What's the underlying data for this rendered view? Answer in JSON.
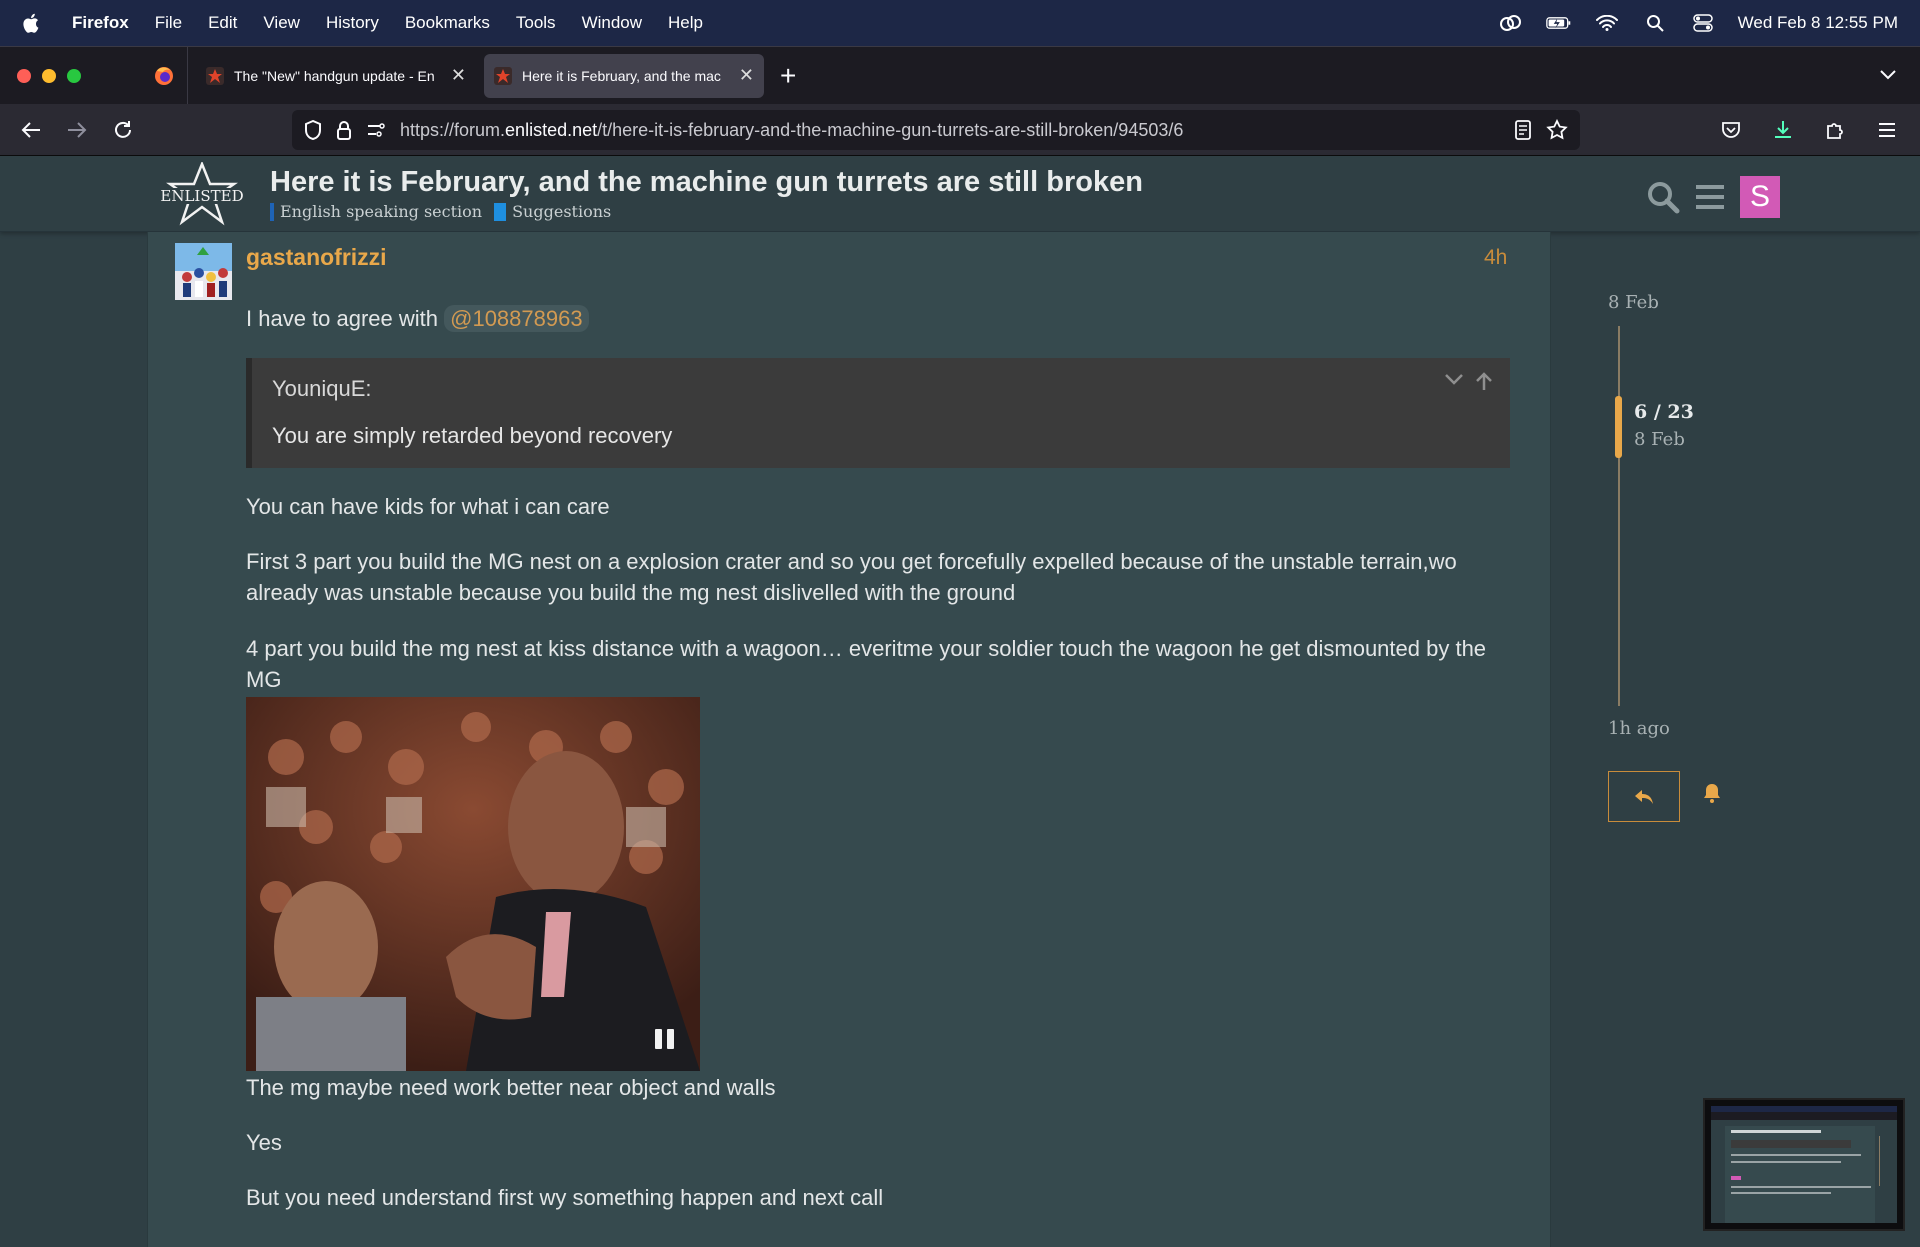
{
  "menubar": {
    "app_name": "Firefox",
    "items": [
      "File",
      "Edit",
      "View",
      "History",
      "Bookmarks",
      "Tools",
      "Window",
      "Help"
    ],
    "clock": "Wed Feb 8  12:55 PM"
  },
  "tabs": [
    {
      "title": "The \"New\" handgun update - En",
      "active": false
    },
    {
      "title": "Here it is February, and the mac",
      "active": true
    }
  ],
  "url": {
    "prefix": "https://forum.",
    "domain": "enlisted.net",
    "path": "/t/here-it-is-february-and-the-machine-gun-turrets-are-still-broken/94503/6"
  },
  "topic": {
    "title": "Here it is February, and the machine gun turrets are still broken",
    "categories": [
      {
        "name": "English speaking section",
        "color": "#1e63b6"
      },
      {
        "name": "Suggestions",
        "color": "#1e8fe0"
      }
    ],
    "avatar_letter": "S"
  },
  "post": {
    "username": "gastanofrizzi",
    "age": "4h",
    "intro_text": "I have to agree with ",
    "mention": "@108878963",
    "quote_author": "YouniquE:",
    "quote_text": "You are simply retarded beyond recovery",
    "paragraphs": [
      "You can have kids for what i can care",
      "First 3 part you build the MG nest on a explosion crater and so you get forcefully expelled because of the unstable terrain,wo already was unstable because you build the mg nest dislivelled with the ground",
      "4 part you build the mg nest at kiss distance with a wagoon… everitme your soldier touch the wagoon he get dismounted by the MG"
    ],
    "paragraphs_after": [
      "The mg maybe need work better near object and walls",
      "Yes",
      "But you need understand first wy something happen and next call"
    ]
  },
  "timeline": {
    "start_date": "8 Feb",
    "position": "6 / 23",
    "position_date": "8 Feb",
    "end_label": "1h ago"
  },
  "colors": {
    "accent": "#e9a84a",
    "background": "#2f3f44",
    "panel": "#364a4e"
  }
}
